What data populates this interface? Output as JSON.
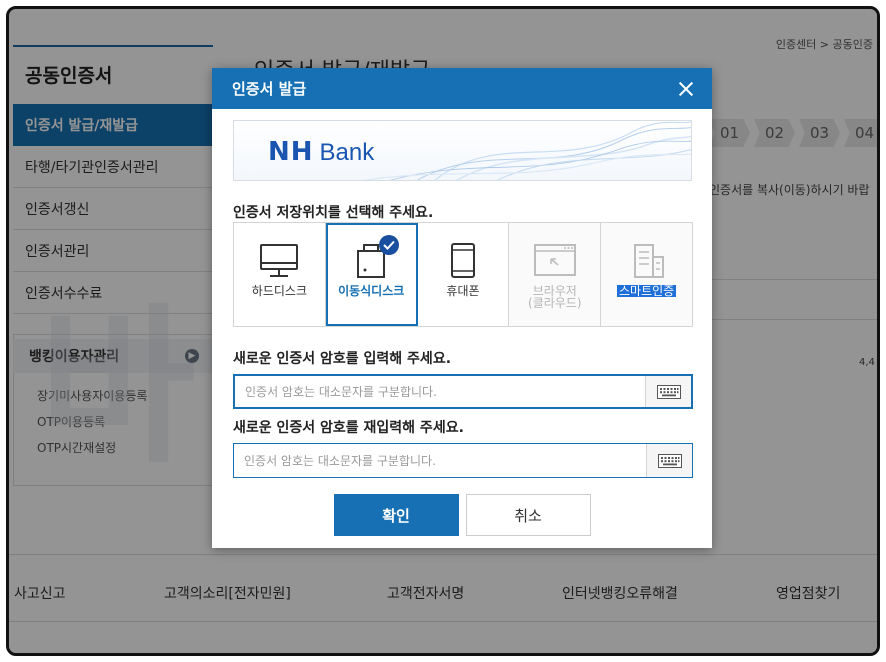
{
  "background": {
    "breadcrumb": "인증센터 > 공동인증",
    "page_title": "인증서 발급/재발급",
    "lnb_title": "공동인증서",
    "lnb_items": [
      {
        "label": "인증서 발급/재발급"
      },
      {
        "label": "타행/타기관인증서관리"
      },
      {
        "label": "인증서갱신"
      },
      {
        "label": "인증서관리"
      },
      {
        "label": "인증서수수료"
      }
    ],
    "lnb_sub_head": "뱅킹이용자관리",
    "lnb_sub_items": [
      {
        "label": "장기미사용자이용등록"
      },
      {
        "label": "OTP이용등록"
      },
      {
        "label": "OTP시간재설정"
      }
    ],
    "steps": [
      "01",
      "02",
      "03",
      "04"
    ],
    "body_text": "인증서를 복사(이동)하시기 바랍",
    "number_text": "4,4",
    "watermark": "바니바니",
    "footer_links": [
      {
        "label": "사고신고"
      },
      {
        "label": "고객의소리[전자민원]"
      },
      {
        "label": "고객전자서명"
      },
      {
        "label": "인터넷뱅킹오류해결"
      },
      {
        "label": "영업점찾기"
      }
    ]
  },
  "modal": {
    "title": "인증서 발급",
    "banner": {
      "brand_nh": "NH",
      "brand_bank": "Bank"
    },
    "storage_label": "인증서 저장위치를 선택해 주세요.",
    "storage_options": [
      {
        "label": "하드디스크",
        "icon": "monitor-icon",
        "state": "normal"
      },
      {
        "label": "이동식디스크",
        "icon": "removable-disk-icon",
        "state": "selected"
      },
      {
        "label": "휴대폰",
        "icon": "phone-icon",
        "state": "normal"
      },
      {
        "label": "브라우저\n(클라우드)",
        "icon": "browser-icon",
        "state": "disabled"
      },
      {
        "label": "스마트인증",
        "icon": "building-icon",
        "state": "disabled"
      }
    ],
    "new_pw_label": "새로운 인증서 암호를 입력해 주세요.",
    "new_pw_placeholder": "인증서 암호는 대소문자를 구분합니다.",
    "confirm_pw_label": "새로운 인증서 암호를 재입력해 주세요.",
    "confirm_pw_placeholder": "인증서 암호는 대소문자를 구분합니다.",
    "confirm_button": "확인",
    "cancel_button": "취소"
  },
  "colors": {
    "primary": "#1670b3",
    "check_badge": "#1a4fa0",
    "brand": "#1a56b0"
  }
}
